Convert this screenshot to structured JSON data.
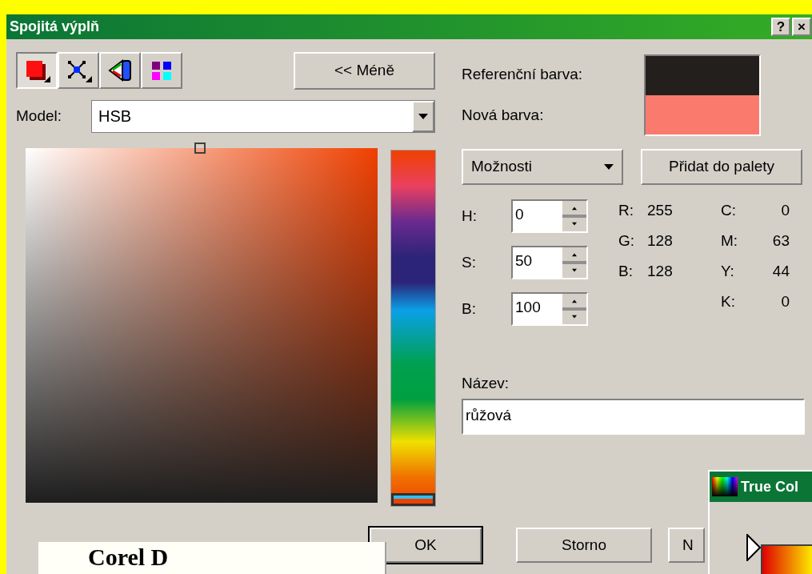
{
  "window": {
    "title": "Spojitá výplň",
    "title_buttons": [
      "?",
      "×"
    ]
  },
  "hue_slider": {
    "level": 1
  },
  "toolbar": {
    "tools": [
      {
        "kind": "fill",
        "selected": true
      },
      {
        "kind": "mixer",
        "selected": false
      },
      {
        "kind": "fan",
        "selected": false
      },
      {
        "kind": "palette",
        "selected": false
      }
    ],
    "less_button": "<< Méně"
  },
  "model": {
    "label": "Model:",
    "value": "HSB"
  },
  "swatches": [
    {
      "label": "Referenční barva:",
      "color": "#231f1d"
    },
    {
      "label": "Nová barva:",
      "color": "#fb7a6e"
    }
  ],
  "options_dropdown": "Možnosti",
  "add_button": "Přidat do palety",
  "hsb": [
    {
      "label": "H:",
      "value": "0"
    },
    {
      "label": "S:",
      "value": "50"
    },
    {
      "label": "B:",
      "value": "100"
    }
  ],
  "rgb": [
    {
      "label": "R:",
      "value": "255"
    },
    {
      "label": "G:",
      "value": "128"
    },
    {
      "label": "B:",
      "value": "128"
    }
  ],
  "cmyk": [
    {
      "label": "C:",
      "value": "0"
    },
    {
      "label": "M:",
      "value": "63"
    },
    {
      "label": "Y:",
      "value": "44"
    },
    {
      "label": "K:",
      "value": "0"
    }
  ],
  "name": {
    "label": "Název:",
    "value": "růžová"
  },
  "buttons": [
    {
      "label": "OK",
      "default": true
    },
    {
      "label": "Storno",
      "default": false
    },
    {
      "label": "N",
      "default": false
    }
  ],
  "true_color_window": {
    "title": "True Col"
  },
  "caption": {
    "text": "Corel D"
  }
}
